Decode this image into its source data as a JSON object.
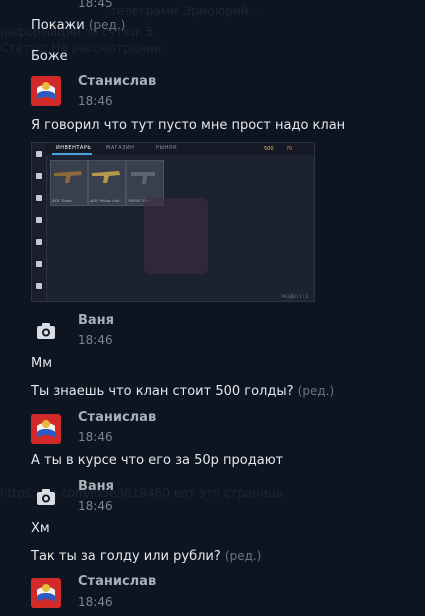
{
  "background_ghost": {
    "line1": "телеграмм Эрмоюрий...",
    "line2": "информаций за сутки: 5",
    "line3": "Статус: На рассмотрении",
    "line4": "https://vk.com/id5e3019460 вот это страница"
  },
  "messages": {
    "top_time": "18:45",
    "m1_text": "Покажи",
    "m1_edited": "(ред.)",
    "m2_text": "Боже",
    "s1_name": "Станислав",
    "s1_time": "18:46",
    "m3_text": "Я говорил что тут пусто мне прост надо клан",
    "v1_name": "Ваня",
    "v1_time": "18:46",
    "m4_text": "Мм",
    "m5_text": "Ты знаешь что клан стоит 500 голды?",
    "m5_edited": "(ред.)",
    "s2_name": "Станислав",
    "s2_time": "18:46",
    "m6_text": "А ты в курсе что его за 50р продают",
    "v2_name": "Ваня",
    "v2_time": "18:46",
    "m7_text": "Хм",
    "m8_text": "Так ты за голду или рубли?",
    "m8_edited": "(ред.)",
    "s3_name": "Станислав",
    "s3_time": "18:46"
  },
  "attachment": {
    "tab_inventory": "ИНВЕНТАРЬ",
    "tab_shop": "МАГАЗИН",
    "tab_market": "РЫНОК",
    "gold": "500",
    "silver": "70",
    "item1": "AKR \"Scale\"",
    "item2": "AKR \"Yellow Line\"",
    "item3": "UMP45 \"Fury\"",
    "footer": "РАЗДЕЛ 1 / 3"
  }
}
